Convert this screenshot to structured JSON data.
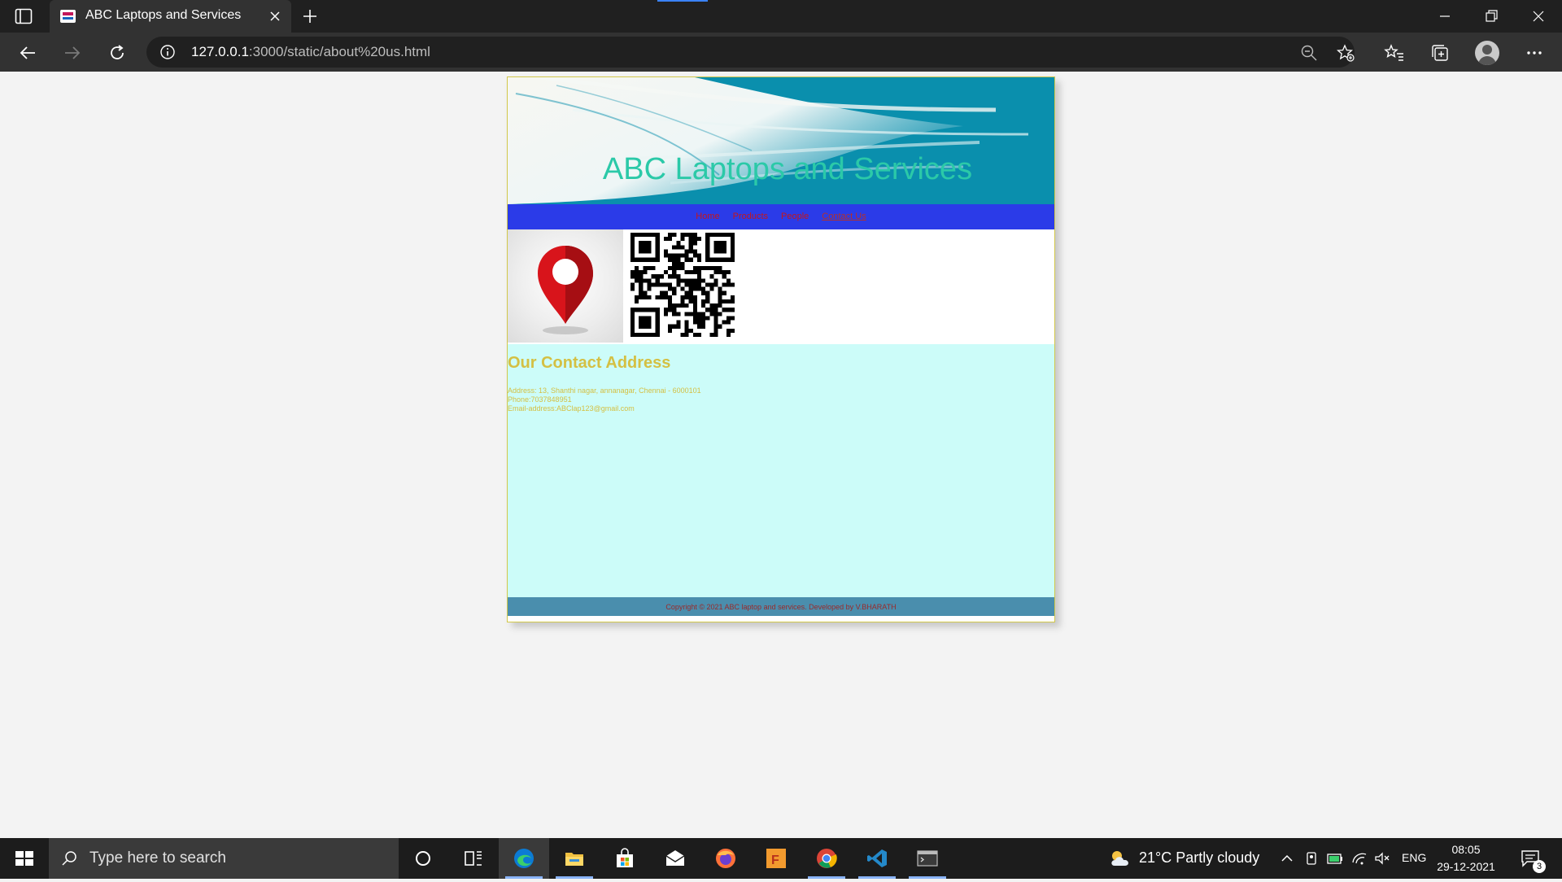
{
  "browser": {
    "tab_title": "ABC Laptops and Services",
    "url_host": "127.0.0.1",
    "url_rest": ":3000/static/about%20us.html"
  },
  "site": {
    "title": "ABC Laptops and Services",
    "nav": [
      {
        "label": "Home"
      },
      {
        "label": "Products"
      },
      {
        "label": "People"
      },
      {
        "label": "Contact Us",
        "current": true
      }
    ],
    "contact": {
      "heading": "Our Contact Address",
      "address": "Address: 13, Shanthi nagar, annanagar, Chennai - 6000101",
      "phone": "Phone:7037848951",
      "email": "Email-address:ABClap123@gmail.com"
    },
    "footer": "Copyright © 2021 ABC laptop and services. Developed by V.BHARATH",
    "colors": {
      "title": "#2bc9a8",
      "nav_bg": "#2b3be8",
      "nav_link": "#c4161c",
      "contact_bg": "#ccfcf9",
      "contact_text": "#d4c043",
      "footer_bg": "#4a8ead"
    },
    "images": [
      "location-pin-icon",
      "qr-code"
    ]
  },
  "taskbar": {
    "search_placeholder": "Type here to search",
    "apps": [
      "task-view-icon",
      "edge-icon",
      "file-explorer-icon",
      "store-icon",
      "mail-icon",
      "firefox-icon",
      "fusion-app-icon",
      "chrome-icon",
      "vscode-icon",
      "terminal-icon"
    ],
    "weather": "21°C  Partly cloudy",
    "language": "ENG",
    "time": "08:05",
    "date": "29-12-2021",
    "notifications": "3"
  }
}
